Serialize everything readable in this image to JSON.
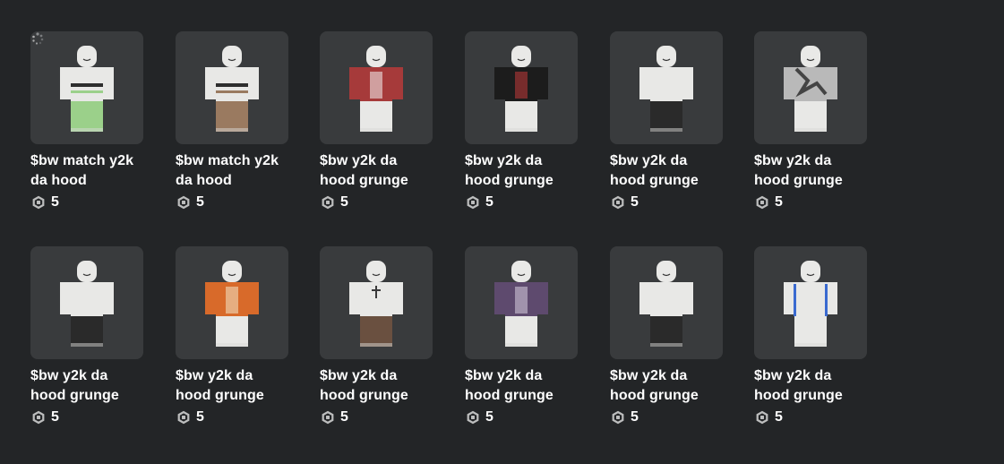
{
  "items": [
    {
      "name": "$bw match y2k da hood",
      "price": "5",
      "shirt": "#e8e8e6",
      "pants": "#9bd08a",
      "accent": "#2e2e2e",
      "style": "green-stripe",
      "loading": true
    },
    {
      "name": "$bw match y2k da hood",
      "price": "5",
      "shirt": "#e8e8e6",
      "pants": "#9a7a60",
      "accent": "#2e2e2e",
      "style": "brown-stripe",
      "loading": false
    },
    {
      "name": "$bw y2k da hood grunge",
      "price": "5",
      "shirt": "#a63a3a",
      "pants": "#e8e8e6",
      "accent": "#f2f2f2",
      "style": "red-jacket",
      "loading": false
    },
    {
      "name": "$bw y2k da hood grunge",
      "price": "5",
      "shirt": "#1c1c1c",
      "pants": "#e8e8e6",
      "accent": "#c23a3a",
      "style": "black-jacket",
      "loading": false
    },
    {
      "name": "$bw y2k da hood grunge",
      "price": "5",
      "shirt": "#e8e8e6",
      "pants": "#2a2a2a",
      "accent": "#cfcfcf",
      "style": "black-pants",
      "loading": false
    },
    {
      "name": "$bw y2k da hood grunge",
      "price": "5",
      "shirt": "#b9b9b9",
      "pants": "#e8e8e6",
      "accent": "#444444",
      "style": "grey-print",
      "loading": false
    },
    {
      "name": "$bw y2k da hood grunge",
      "price": "5",
      "shirt": "#e8e8e6",
      "pants": "#2a2a2a",
      "accent": "#e0642a",
      "style": "black-shorts",
      "loading": false
    },
    {
      "name": "$bw y2k da hood grunge",
      "price": "5",
      "shirt": "#d86a2a",
      "pants": "#e8e8e6",
      "accent": "#f2e6c8",
      "style": "orange-jacket",
      "loading": false
    },
    {
      "name": "$bw y2k da hood grunge",
      "price": "5",
      "shirt": "#e8e8e6",
      "pants": "#6a5040",
      "accent": "#3a3a3a",
      "style": "cross-shirt",
      "loading": false
    },
    {
      "name": "$bw y2k da hood grunge",
      "price": "5",
      "shirt": "#5e4a6e",
      "pants": "#e8e8e6",
      "accent": "#d8d0e0",
      "style": "purple-jacket",
      "loading": false
    },
    {
      "name": "$bw y2k da hood grunge",
      "price": "5",
      "shirt": "#e8e8e6",
      "pants": "#2a2a2a",
      "accent": "#bdbdbd",
      "style": "black-pants-2",
      "loading": false
    },
    {
      "name": "$bw y2k da hood grunge",
      "price": "5",
      "shirt": "#e8e8e6",
      "pants": "#e8e8e6",
      "accent": "#3a6ad0",
      "style": "blue-trim",
      "loading": false
    }
  ],
  "icons": {
    "price_icon": "robux-icon",
    "loading_icon": "loading-spinner-icon"
  }
}
